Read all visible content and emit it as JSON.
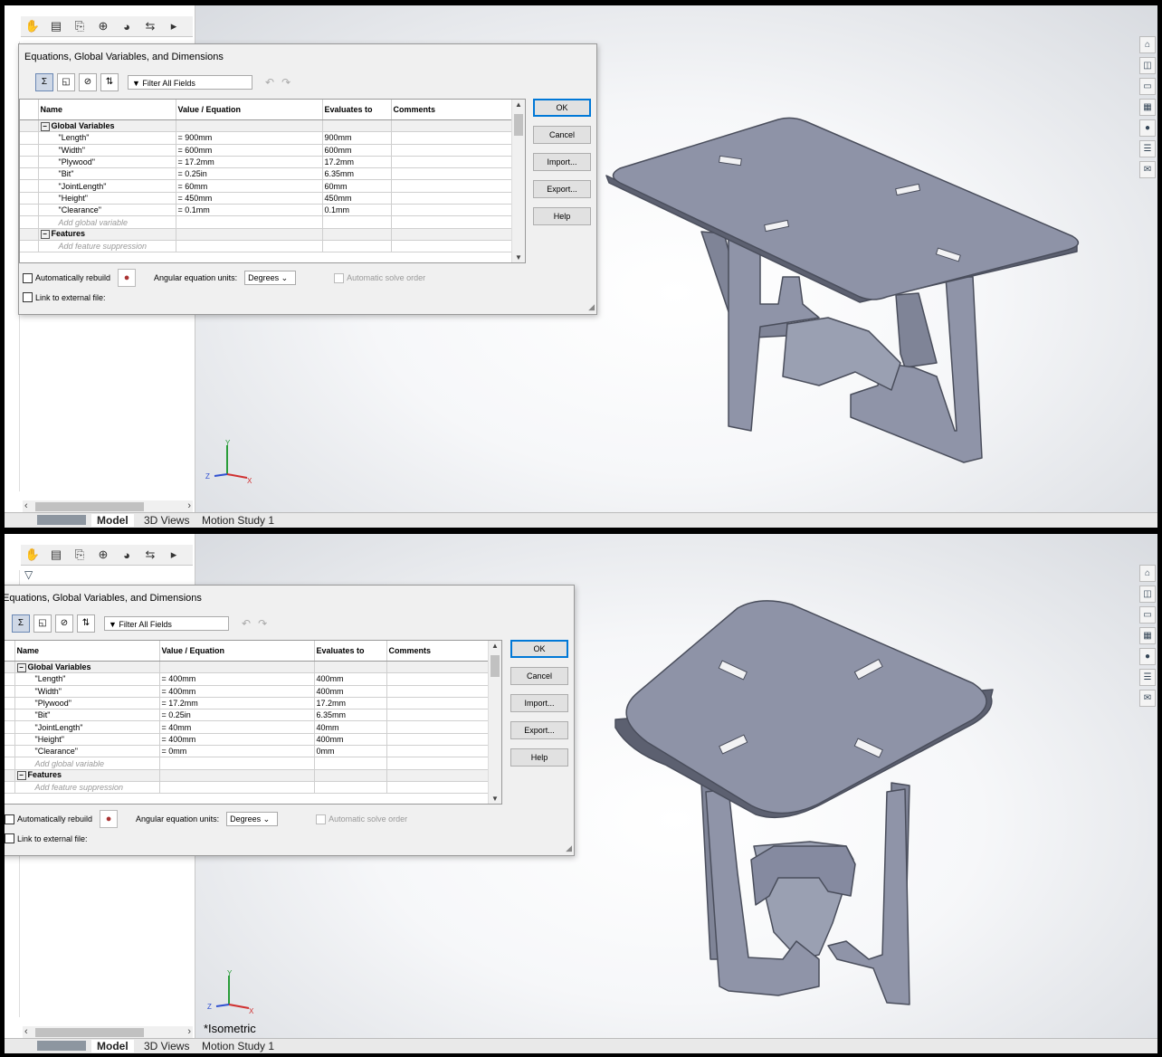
{
  "dialog_title": "Equations, Global Variables, and Dimensions",
  "filter_placeholder": "Filter All Fields",
  "columns": [
    "Name",
    "Value / Equation",
    "Evaluates to",
    "Comments"
  ],
  "sections": {
    "global": "Global Variables",
    "features": "Features"
  },
  "placeholders": {
    "add_global": "Add global variable",
    "add_feature": "Add feature suppression"
  },
  "buttons": {
    "ok": "OK",
    "cancel": "Cancel",
    "import": "Import...",
    "export": "Export...",
    "help": "Help"
  },
  "options": {
    "auto_rebuild": "Automatically rebuild",
    "angular_units_label": "Angular equation units:",
    "angular_units_value": "Degrees",
    "auto_solve": "Automatic solve order",
    "link_external": "Link to external file:"
  },
  "bottom_tabs": [
    "Model",
    "3D Views",
    "Motion Study 1"
  ],
  "view_label_bottom": "*Isometric",
  "top": {
    "rows": [
      {
        "name": "\"Length\"",
        "value": "= 900mm",
        "eval": "900mm"
      },
      {
        "name": "\"Width\"",
        "value": "= 600mm",
        "eval": "600mm"
      },
      {
        "name": "\"Plywood\"",
        "value": "= 17.2mm",
        "eval": "17.2mm"
      },
      {
        "name": "\"Bit\"",
        "value": "= 0.25in",
        "eval": "6.35mm"
      },
      {
        "name": "\"JointLength\"",
        "value": "= 60mm",
        "eval": "60mm"
      },
      {
        "name": "\"Height\"",
        "value": "= 450mm",
        "eval": "450mm"
      },
      {
        "name": "\"Clearance\"",
        "value": "= 0.1mm",
        "eval": "0.1mm"
      }
    ]
  },
  "bottom": {
    "rows": [
      {
        "name": "\"Length\"",
        "value": "= 400mm",
        "eval": "400mm"
      },
      {
        "name": "\"Width\"",
        "value": "= 400mm",
        "eval": "400mm"
      },
      {
        "name": "\"Plywood\"",
        "value": "= 17.2mm",
        "eval": "17.2mm"
      },
      {
        "name": "\"Bit\"",
        "value": "= 0.25in",
        "eval": "6.35mm"
      },
      {
        "name": "\"JointLength\"",
        "value": "= 40mm",
        "eval": "40mm"
      },
      {
        "name": "\"Height\"",
        "value": "= 400mm",
        "eval": "400mm"
      },
      {
        "name": "\"Clearance\"",
        "value": "= 0mm",
        "eval": "0mm"
      }
    ]
  },
  "colors": {
    "model_face": "#8f94a8",
    "model_edge": "#4a4e5c",
    "accent": "#0078d7"
  }
}
